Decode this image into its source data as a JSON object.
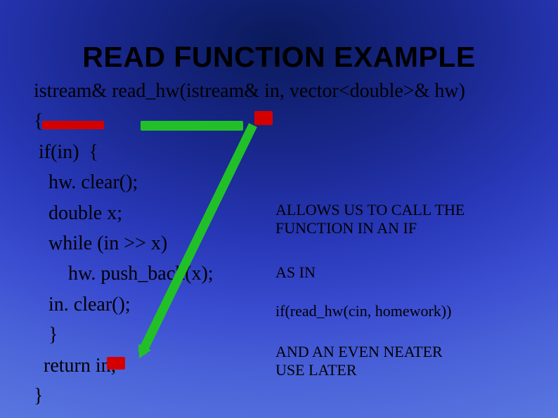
{
  "title": "READ FUNCTION EXAMPLE",
  "code": {
    "l1": "istream& read_hw(istream& in, vector<double>& hw)",
    "l2": "{",
    "l3": " if(in)  {",
    "l4": "   hw. clear();",
    "l5": "   double x;",
    "l6": "   while (in >> x)",
    "l7": "       hw. push_back(x);",
    "l8": "   in. clear();",
    "l9": "   }",
    "l10": "  return in;",
    "l11": "}"
  },
  "annotations": {
    "a1_line1": "ALLOWS US TO CALL THE",
    "a1_line2": "FUNCTION IN AN IF",
    "a2": "AS IN",
    "a3": "if(read_hw(cin, homework))",
    "a4_line1": "AND AN EVEN NEATER",
    "a4_line2": "USE LATER"
  },
  "colors": {
    "highlight_red": "#d40000",
    "highlight_green": "#22c028",
    "bg_top": "#0a1a5a",
    "bg_bottom": "#5a78e0"
  }
}
